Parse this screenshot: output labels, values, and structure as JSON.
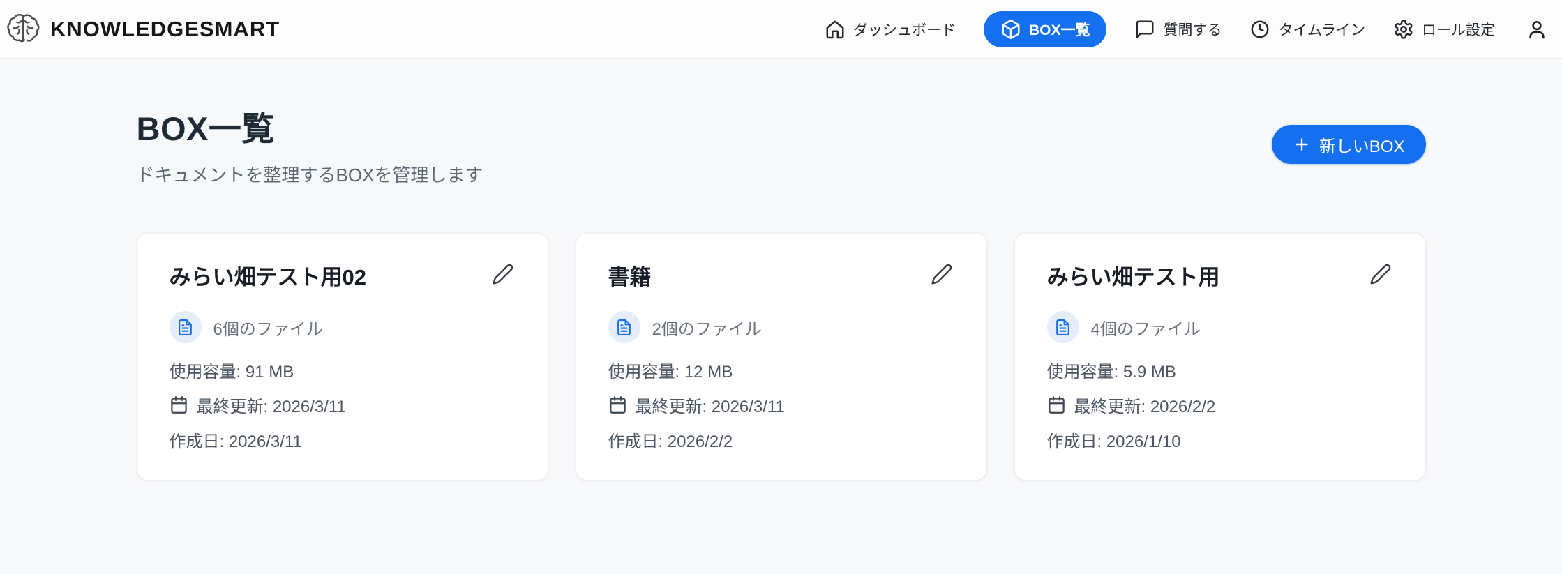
{
  "colors": {
    "accent": "#1570ef",
    "accent_light": "#e5edfb"
  },
  "brand": {
    "name": "KNOWLEDGESMART"
  },
  "nav": {
    "items": [
      {
        "label": "ダッシュボード",
        "icon": "home-icon",
        "active": false
      },
      {
        "label": "BOX一覧",
        "icon": "box-icon",
        "active": true
      },
      {
        "label": "質問する",
        "icon": "chat-icon",
        "active": false
      },
      {
        "label": "タイムライン",
        "icon": "clock-icon",
        "active": false
      },
      {
        "label": "ロール設定",
        "icon": "gear-icon",
        "active": false
      }
    ],
    "user_icon": "user-icon"
  },
  "page": {
    "title": "BOX一覧",
    "subtitle": "ドキュメントを整理するBOXを管理します",
    "new_box_button": "新しいBOX"
  },
  "boxes": [
    {
      "title": "みらい畑テスト用02",
      "file_count": "6個のファイル",
      "storage": "使用容量: 91 MB",
      "last_updated": "最終更新: 2026/3/11",
      "created": "作成日: 2026/3/11"
    },
    {
      "title": "書籍",
      "file_count": "2個のファイル",
      "storage": "使用容量: 12 MB",
      "last_updated": "最終更新: 2026/3/11",
      "created": "作成日: 2026/2/2"
    },
    {
      "title": "みらい畑テスト用",
      "file_count": "4個のファイル",
      "storage": "使用容量: 5.9 MB",
      "last_updated": "最終更新: 2026/2/2",
      "created": "作成日: 2026/1/10"
    }
  ]
}
